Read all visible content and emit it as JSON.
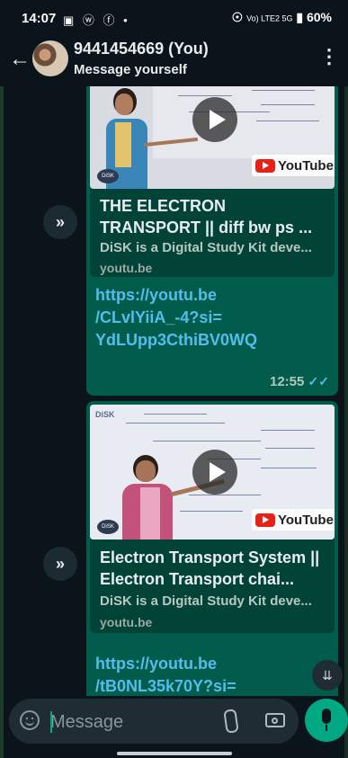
{
  "status_bar": {
    "time": "14:07",
    "left_icons": "▣ ⓦ ⓕ •",
    "network": "Vo) LTE2 5G",
    "battery": "60%"
  },
  "header": {
    "title": "9441454669 (You)",
    "subtitle": "Message yourself"
  },
  "messages": [
    {
      "preview_title": "THE ELECTRON TRANSPORT || diff bw ps ...",
      "preview_description": "DiSK is a Digital Study Kit deve...",
      "preview_domain": "youtu.be",
      "link_lines": [
        "https://youtu.be",
        "/CLvlYiiA_-4?si=",
        "YdLUpp3CthiBV0WQ"
      ],
      "time": "12:55",
      "ticks": "✓✓",
      "youtube_badge": "YouTube"
    },
    {
      "thumb_label": "DiSK",
      "preview_title": "Electron Transport System || Electron Transport chai...",
      "preview_description": "DiSK is a Digital Study Kit deve...",
      "preview_domain": "youtu.be",
      "link_lines": [
        "https://youtu.be",
        "/tB0NL35k70Y?si="
      ],
      "youtube_badge": "YouTube"
    }
  ],
  "composer": {
    "placeholder": "Message"
  },
  "colors": {
    "background": "#0b141a",
    "outgoing_bubble": "#025c4c",
    "link": "#53bdeb",
    "accent": "#00a884"
  },
  "icons": {
    "back": "arrow-left-icon",
    "menu": "more-vertical-icon",
    "forward": "forward-icon",
    "scroll": "chevron-double-down-icon",
    "emoji": "emoji-icon",
    "attach": "paperclip-icon",
    "camera": "camera-icon",
    "mic": "microphone-icon"
  }
}
